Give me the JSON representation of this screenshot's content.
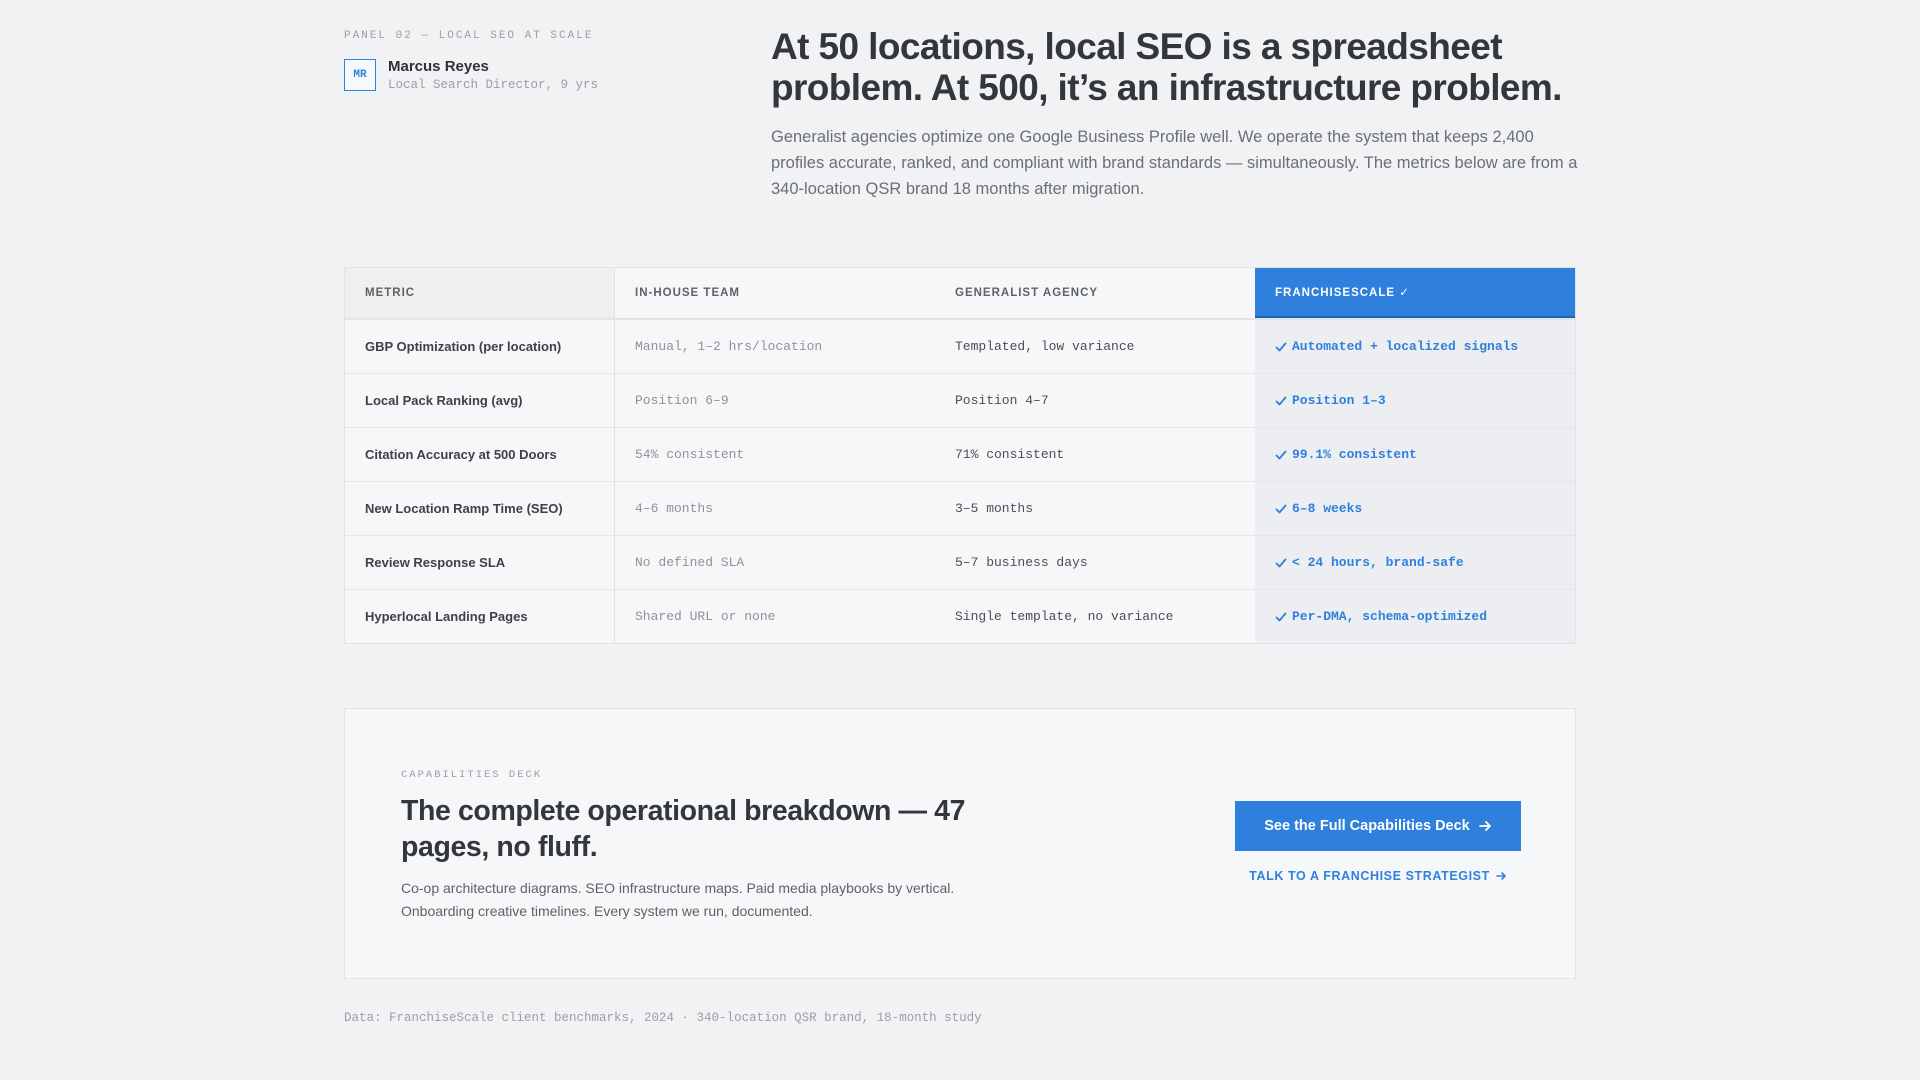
{
  "panel_label": "PANEL 02 — LOCAL SEO AT SCALE",
  "author": {
    "initials": "MR",
    "name": "Marcus Reyes",
    "role": "Local Search Director, 9 yrs"
  },
  "headline": "At 50 locations, local SEO is a spreadsheet problem. At 500, it’s an infrastructure problem.",
  "intro": "Generalist agencies optimize one Google Business Profile well. We operate the system that keeps 2,400 profiles accurate, ranked, and compliant with brand standards — simultaneously. The metrics below are from a 340-location QSR brand 18 months after migration.",
  "table": {
    "headers": [
      "METRIC",
      "IN-HOUSE TEAM",
      "GENERALIST AGENCY",
      "FRANCHISESCALE ✓"
    ],
    "rows": [
      {
        "metric": "GBP Optimization (per location)",
        "inhouse": "Manual, 1–2 hrs/location",
        "agency": "Templated, low variance",
        "franchisescale": "Automated + localized signals"
      },
      {
        "metric": "Local Pack Ranking (avg)",
        "inhouse": "Position 6–9",
        "agency": "Position 4–7",
        "franchisescale": "Position 1–3"
      },
      {
        "metric": "Citation Accuracy at 500 Doors",
        "inhouse": "54% consistent",
        "agency": "71% consistent",
        "franchisescale": "99.1% consistent"
      },
      {
        "metric": "New Location Ramp Time (SEO)",
        "inhouse": "4–6 months",
        "agency": "3–5 months",
        "franchisescale": "6–8 weeks"
      },
      {
        "metric": "Review Response SLA",
        "inhouse": "No defined SLA",
        "agency": "5–7 business days",
        "franchisescale": "< 24 hours, brand-safe"
      },
      {
        "metric": "Hyperlocal Landing Pages",
        "inhouse": "Shared URL or none",
        "agency": "Single template, no variance",
        "franchisescale": "Per-DMA, schema-optimized"
      }
    ]
  },
  "cta": {
    "label": "CAPABILITIES DECK",
    "title": "The complete operational breakdown — 47 pages, no fluff.",
    "description": "Co-op architecture diagrams. SEO infrastructure maps. Paid media playbooks by vertical. Onboarding creative timelines. Every system we run, documented.",
    "primary_button": "See the Full Capabilities Deck",
    "secondary_link": "TALK TO A FRANCHISE STRATEGIST"
  },
  "footnote": "Data: FranchiseScale client benchmarks, 2024 · 340-location QSR brand, 18-month study",
  "colors": {
    "accent": "#2f80dd",
    "background": "#f1f2f4"
  }
}
